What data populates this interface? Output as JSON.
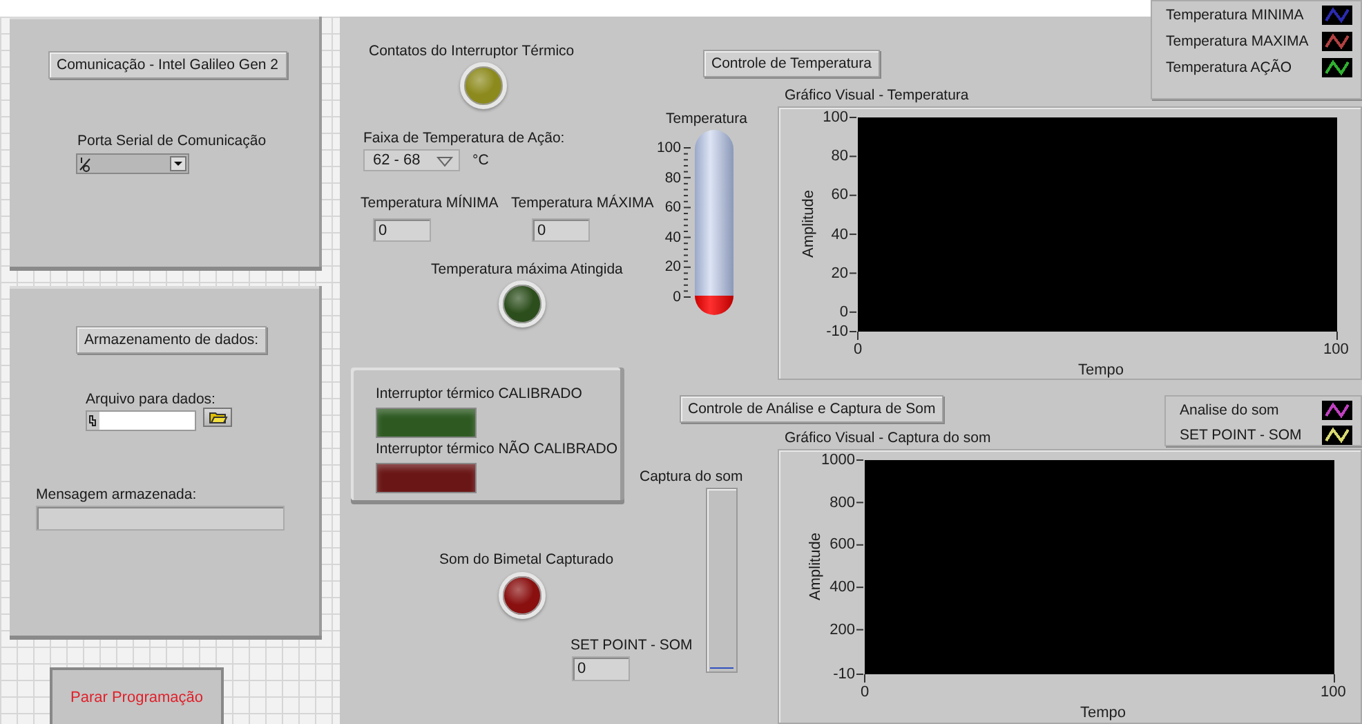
{
  "communication": {
    "title": "Comunicação - Intel Galileo Gen 2",
    "serial_port": {
      "label": "Porta Serial de Comunicação"
    }
  },
  "storage": {
    "title": "Armazenamento de dados:",
    "file": {
      "label": "Arquivo para dados:"
    },
    "message": {
      "label": "Mensagem armazenada:"
    }
  },
  "stop_button": {
    "label": "Parar Programação"
  },
  "leds": [
    {
      "kind": "contacts",
      "label": "Contatos do Interruptor Térmico",
      "color": "#8c8a1c"
    },
    {
      "kind": "max_reached",
      "label": "Temperatura máxima Atingida",
      "color": "#2c4e1c"
    },
    {
      "kind": "sound",
      "label": "Som do Bimetal Capturado",
      "color": "#8a1010"
    }
  ],
  "action_range": {
    "label": "Faixa de Temperatura de Ação:",
    "value": "62 - 68",
    "unit": "°C"
  },
  "temp_min": {
    "label": "Temperatura MÍNIMA",
    "value": "0"
  },
  "temp_max": {
    "label": "Temperatura MÁXIMA",
    "value": "0"
  },
  "thermometer": {
    "label": "Temperatura",
    "ticks": [
      "100",
      "80",
      "60",
      "40",
      "20",
      "0"
    ],
    "level": 0
  },
  "calibration": [
    {
      "label": "Interruptor térmico CALIBRADO",
      "color": "#2e5a22"
    },
    {
      "label": "Interruptor térmico NÃO CALIBRADO",
      "color": "#6a1616"
    }
  ],
  "sound_capture": {
    "label": "Captura do som",
    "level": 0
  },
  "setpoint": {
    "label": "SET POINT - SOM",
    "value": "0"
  },
  "temperature_section": {
    "title": "Controle de Temperatura",
    "graph": {
      "title": "Gráfico Visual - Temperatura",
      "xlabel": "Tempo",
      "ylabel": "Amplitude",
      "y_ticks": [
        "100",
        "80",
        "60",
        "40",
        "20",
        "0",
        "-10"
      ],
      "x_ticks": [
        "0",
        "100"
      ],
      "legend": [
        {
          "name": "Temperatura MINIMA",
          "color": "#2a2ab0"
        },
        {
          "name": "Temperatura MAXIMA",
          "color": "#b04040"
        },
        {
          "name": "Temperatura AÇÃO",
          "color": "#30b030"
        }
      ]
    }
  },
  "sound_section": {
    "title": "Controle de Análise e Captura de Som",
    "graph": {
      "title": "Gráfico Visual - Captura do som",
      "xlabel": "Tempo",
      "ylabel": "Amplitude",
      "y_ticks": [
        "1000",
        "800",
        "600",
        "400",
        "200",
        "-10"
      ],
      "x_ticks": [
        "0",
        "100"
      ],
      "legend": [
        {
          "name": "Analise do som",
          "color": "#c040c0"
        },
        {
          "name": "SET POINT - SOM",
          "color": "#d8d870"
        }
      ]
    }
  }
}
